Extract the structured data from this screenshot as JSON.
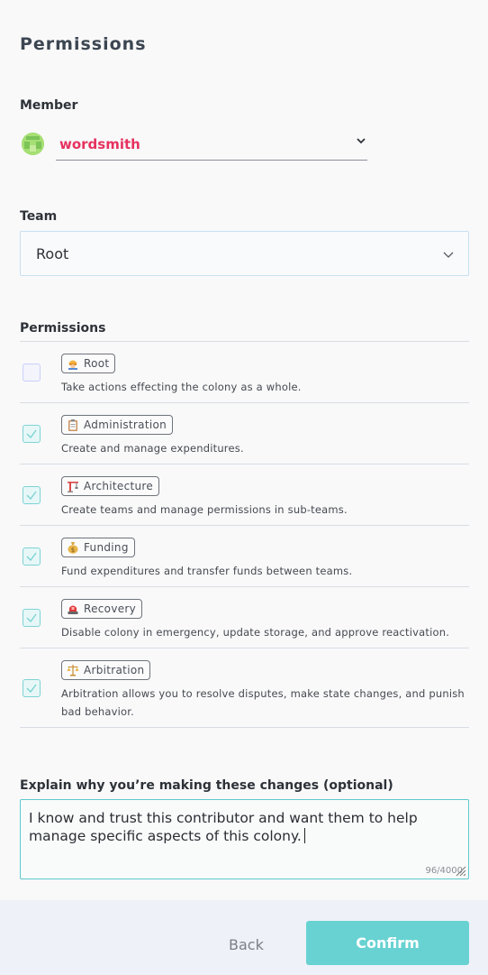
{
  "dialog": {
    "title": "Permissions"
  },
  "member": {
    "label": "Member",
    "selected": "wordsmith",
    "name_color": "#e6325f"
  },
  "team": {
    "label": "Team",
    "selected": "Root"
  },
  "permissions": {
    "label": "Permissions",
    "items": [
      {
        "name": "Root",
        "icon": "construction-worker-icon",
        "description": "Take actions effecting the colony as a whole.",
        "checked": false
      },
      {
        "name": "Administration",
        "icon": "clipboard-icon",
        "description": "Create and manage expenditures.",
        "checked": true
      },
      {
        "name": "Architecture",
        "icon": "crane-icon",
        "description": "Create teams and manage permissions in sub-teams.",
        "checked": true
      },
      {
        "name": "Funding",
        "icon": "money-bag-icon",
        "description": "Fund expenditures and transfer funds between teams.",
        "checked": true
      },
      {
        "name": "Recovery",
        "icon": "siren-icon",
        "description": "Disable colony in emergency, update storage, and approve reactivation.",
        "checked": true
      },
      {
        "name": "Arbitration",
        "icon": "scales-icon",
        "description": "Arbitration allows you to resolve disputes, make state changes, and punish bad behavior.",
        "checked": true
      }
    ]
  },
  "annotation": {
    "label": "Explain why you’re making these changes (optional)",
    "value": "I know and trust this contributor and want them to help manage specific aspects of this colony.",
    "counter": "96/4000"
  },
  "footer": {
    "back_label": "Back",
    "confirm_label": "Confirm",
    "confirm_color": "#68d2d2"
  }
}
